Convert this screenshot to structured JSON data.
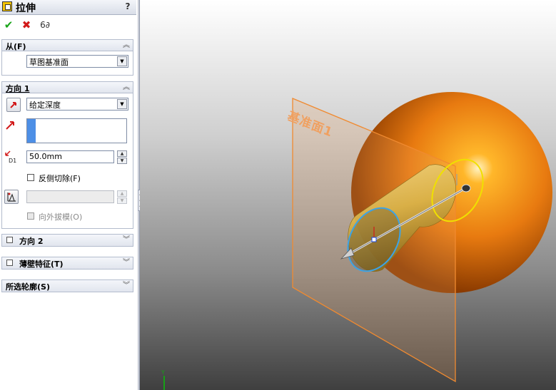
{
  "window": {
    "feature_title": "拉伸",
    "help": "?"
  },
  "toolbar": {
    "ok": "✔",
    "cancel": "✖",
    "preview": "6∂"
  },
  "from_group": {
    "header": "从(F)",
    "start_condition": "草图基准面"
  },
  "direction1": {
    "header": "方向 1",
    "end_condition": "给定深度",
    "depth": "50.0mm",
    "reverse_cut_label": "反侧切除(F)",
    "draft_angle": "",
    "draft_outward_label": "向外拔模(O)"
  },
  "direction2": {
    "header": "方向 2"
  },
  "thin_feature": {
    "header": "薄壁特征(T)"
  },
  "selected_contours": {
    "header": "所选轮廓(S)"
  },
  "viewport": {
    "plane_label": "基准面1",
    "triad_y": "Y",
    "colors": {
      "sphere": "#e87a10",
      "cylinder": "#d9b44a",
      "plane_edge": "#f08a30",
      "start_circle": "#3ba3e6",
      "end_circle": "#f0e000"
    }
  }
}
